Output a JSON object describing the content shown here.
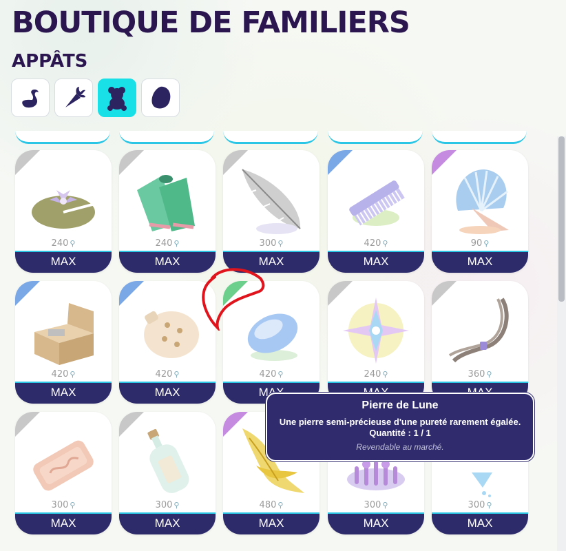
{
  "page": {
    "title": "BOUTIQUE DE FAMILIERS",
    "subtitle": "APPÂTS"
  },
  "categories": [
    {
      "icon": "swan-icon",
      "active": false
    },
    {
      "icon": "carrot-icon",
      "active": false
    },
    {
      "icon": "teddy-bear-icon",
      "active": true
    },
    {
      "icon": "egg-icon",
      "active": false
    }
  ],
  "items": [
    {
      "icon": "water-lily-icon",
      "price": "240",
      "button": "MAX",
      "corner": "#c8c8c8"
    },
    {
      "icon": "swim-fins-icon",
      "price": "240",
      "button": "MAX",
      "corner": "#c8c8c8"
    },
    {
      "icon": "feather-icon",
      "price": "300",
      "button": "MAX",
      "corner": "#c8c8c8"
    },
    {
      "icon": "comb-icon",
      "price": "420",
      "button": "MAX",
      "corner": "#7aa7e6"
    },
    {
      "icon": "shell-fan-icon",
      "price": "90",
      "button": "MAX",
      "corner": "#c58be0"
    },
    {
      "icon": "music-box-icon",
      "price": "420",
      "button": "MAX",
      "corner": "#7aa7e6"
    },
    {
      "icon": "ocarina-icon",
      "price": "420",
      "button": "MAX",
      "corner": "#7aa7e6"
    },
    {
      "icon": "moonstone-icon",
      "price": "420",
      "button": "MAX",
      "corner": "#6ccf8c"
    },
    {
      "icon": "crystal-star-icon",
      "price": "240",
      "button": "MAX",
      "corner": "#c8c8c8"
    },
    {
      "icon": "hair-lock-icon",
      "price": "360",
      "button": "MAX",
      "corner": "#c8c8c8"
    },
    {
      "icon": "soap-bar-icon",
      "price": "300",
      "button": "MAX",
      "corner": "#c8c8c8"
    },
    {
      "icon": "message-bottle-icon",
      "price": "300",
      "button": "MAX",
      "corner": "#c8c8c8"
    },
    {
      "icon": "golden-veil-icon",
      "price": "480",
      "button": "MAX",
      "corner": "#c58be0"
    },
    {
      "icon": "purple-coral-icon",
      "price": "300",
      "button": "MAX",
      "corner": "#c8c8c8"
    },
    {
      "icon": "water-drop-icon",
      "price": "300",
      "button": "MAX",
      "corner": "#c8c8c8"
    }
  ],
  "tooltip": {
    "title": "Pierre de Lune",
    "description": "Une pierre semi-précieuse d'une pureté rarement égalée.",
    "quantity": "Quantité : 1 / 1",
    "note": "Revendable au marché."
  },
  "colors": {
    "title": "#2b1650",
    "active_category": "#19e0e6",
    "button_bg": "#2e2b6a",
    "accent_line": "#2bc6e6",
    "tooltip_bg": "#2f2b6c",
    "annotation": "#e0141c"
  }
}
